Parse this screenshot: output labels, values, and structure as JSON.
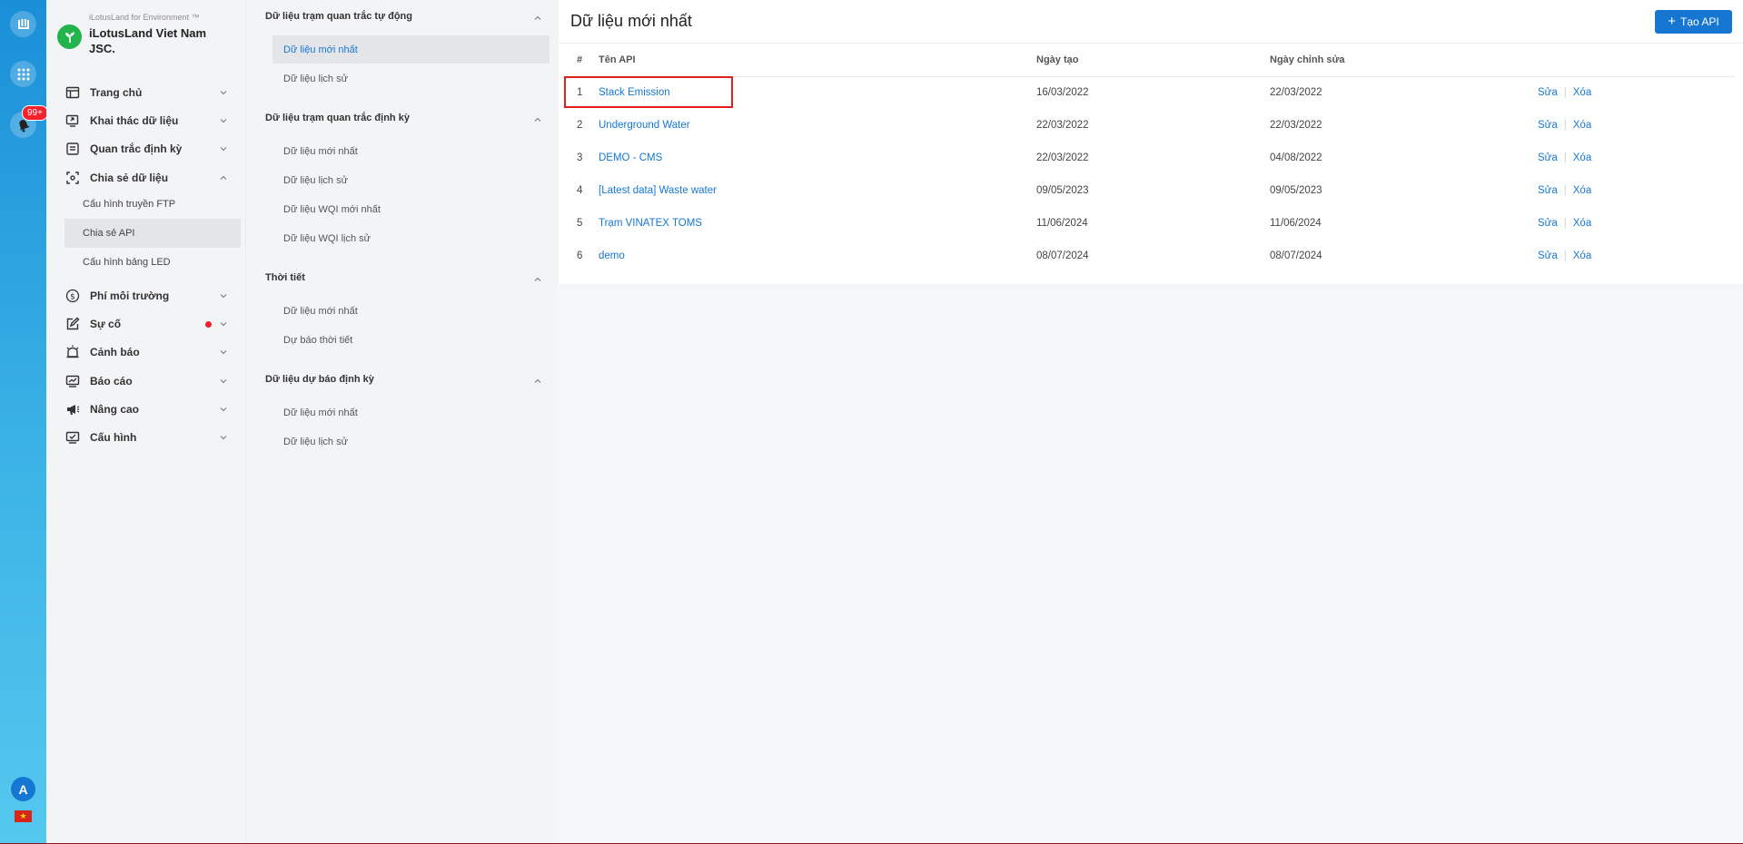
{
  "rail": {
    "badge": "99+",
    "avatar": "A",
    "flag": "★",
    "icons": [
      "app-logo-icon",
      "apps-grid-icon",
      "notification-bell-icon"
    ]
  },
  "brand": {
    "sub": "iLotusLand for Environment ™",
    "name": "iLotusLand Viet Nam JSC."
  },
  "nav": {
    "items": [
      {
        "label": "Trang chủ",
        "icon": "home-icon"
      },
      {
        "label": "Khai thác dữ liệu",
        "icon": "data-mining-icon"
      },
      {
        "label": "Quan trắc định kỳ",
        "icon": "periodic-monitoring-icon"
      },
      {
        "label": "Chia sẻ dữ liệu",
        "icon": "data-share-icon"
      },
      {
        "label": "Phí môi trường",
        "icon": "dollar-icon"
      },
      {
        "label": "Sự cố",
        "icon": "incident-icon"
      },
      {
        "label": "Cảnh báo",
        "icon": "alarm-icon"
      },
      {
        "label": "Báo cáo",
        "icon": "report-icon"
      },
      {
        "label": "Nâng cao",
        "icon": "megaphone-icon"
      },
      {
        "label": "Cấu hình",
        "icon": "config-icon"
      }
    ],
    "share_sub": [
      {
        "label": "Cấu hình truyền FTP"
      },
      {
        "label": "Chia sẻ API"
      },
      {
        "label": "Cấu hình bảng LED"
      }
    ]
  },
  "menu2": {
    "groups": [
      {
        "label": "Dữ liệu trạm quan trắc tự động",
        "items": [
          "Dữ liệu mới nhất",
          "Dữ liệu lịch sử"
        ]
      },
      {
        "label": "Dữ liệu trạm quan trắc định kỳ",
        "items": [
          "Dữ liệu mới nhất",
          "Dữ liệu lịch sử",
          "Dữ liệu WQI mới nhất",
          "Dữ liệu WQI lịch sử"
        ]
      },
      {
        "label": "Thời tiết",
        "items": [
          "Dữ liệu mới nhất",
          "Dự báo thời tiết"
        ]
      },
      {
        "label": "Dữ liệu dự báo định kỳ",
        "items": [
          "Dữ liệu mới nhất",
          "Dữ liệu lịch sử"
        ]
      }
    ]
  },
  "main": {
    "title": "Dữ liệu mới nhất",
    "create_button": "Tạo API",
    "columns": {
      "index": "#",
      "name": "Tên API",
      "created": "Ngày tạo",
      "modified": "Ngày chỉnh sửa"
    },
    "edit_label": "Sửa",
    "delete_label": "Xóa",
    "separator": "|",
    "rows": [
      {
        "index": "1",
        "name": "Stack Emission",
        "created": "16/03/2022",
        "modified": "22/03/2022"
      },
      {
        "index": "2",
        "name": "Underground Water",
        "created": "22/03/2022",
        "modified": "22/03/2022"
      },
      {
        "index": "3",
        "name": "DEMO - CMS",
        "created": "22/03/2022",
        "modified": "04/08/2022"
      },
      {
        "index": "4",
        "name": "[Latest data] Waste water",
        "created": "09/05/2023",
        "modified": "09/05/2023"
      },
      {
        "index": "5",
        "name": "Trạm VINATEX TOMS",
        "created": "11/06/2024",
        "modified": "11/06/2024"
      },
      {
        "index": "6",
        "name": "demo",
        "created": "08/07/2024",
        "modified": "08/07/2024"
      }
    ]
  },
  "colors": {
    "accent": "#1677d2",
    "highlight": "#e0201f",
    "brand": "#22b34c"
  }
}
